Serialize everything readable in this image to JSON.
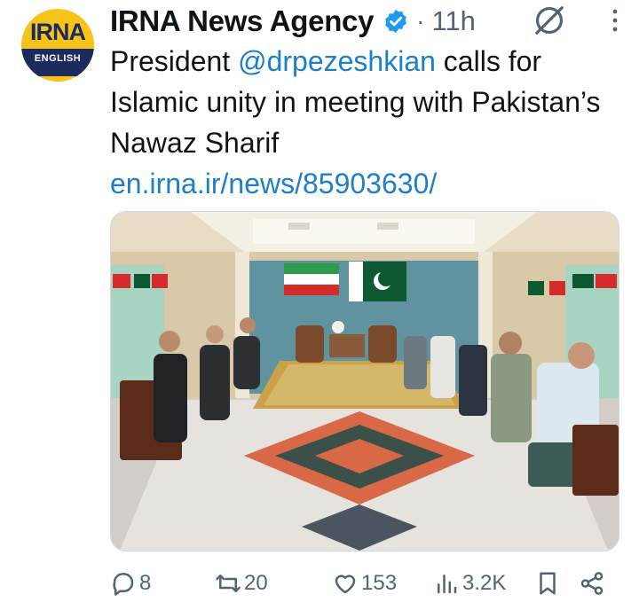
{
  "account": {
    "avatar_text": "IRNA",
    "avatar_sub": "ENGLISH",
    "name": "IRNA News Agency",
    "separator": "·",
    "time": "11h"
  },
  "post": {
    "text_before": "President ",
    "mention": "@drpezeshkian",
    "text_after": " calls for Islamic unity in meeting with Pakistan’s Nawaz Sharif",
    "link": "en.irna.ir/news/85903630/"
  },
  "stats": {
    "replies": "8",
    "reposts": "20",
    "likes": "153",
    "views": "3.2K"
  },
  "colors": {
    "link": "#1d7fc8",
    "muted": "#536471",
    "verified": "#1d9bf0",
    "avatar_bg": "#f7c21a",
    "avatar_navy": "#1c2b5e"
  },
  "icons": [
    "verified-badge-icon",
    "grok-icon",
    "more-icon",
    "reply-icon",
    "repost-icon",
    "like-icon",
    "views-icon",
    "bookmark-icon",
    "share-icon"
  ]
}
